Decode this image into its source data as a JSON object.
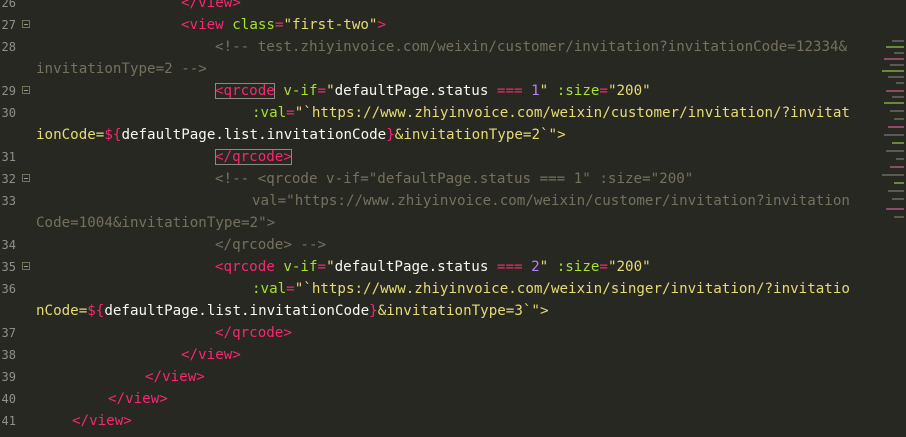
{
  "editor": {
    "lines": [
      {
        "num": "26",
        "fold": false,
        "text_a": "</view>"
      },
      {
        "num": "27",
        "fold": true
      },
      {
        "num": "28",
        "fold": false,
        "comment_a": "<!-- test.zhiyinvoice.com/weixin/customer/invitation?invitationCode=12334&",
        "comment_b": "invitationType=2 -->"
      },
      {
        "num": "29",
        "fold": true
      },
      {
        "num": "30",
        "fold": false
      },
      {
        "num": "31",
        "fold": false
      },
      {
        "num": "32",
        "fold": true,
        "comment_a": "<!-- <qrcode v-if=\"defaultPage.status === 1\" :size=\"200\""
      },
      {
        "num": "33",
        "fold": false,
        "comment_a": "val=\"https://www.zhiyinvoice.com/weixin/customer/invitation?invitation",
        "comment_b": "Code=1004&invitationType=2\">"
      },
      {
        "num": "34",
        "fold": false,
        "comment_a": "</qrcode> -->"
      },
      {
        "num": "35",
        "fold": true
      },
      {
        "num": "36",
        "fold": false
      },
      {
        "num": "37",
        "fold": false
      },
      {
        "num": "38",
        "fold": false
      },
      {
        "num": "39",
        "fold": false
      },
      {
        "num": "40",
        "fold": false
      },
      {
        "num": "41",
        "fold": false
      }
    ],
    "tokens": {
      "view_open": "<view",
      "class_attr": " class",
      "eq": "=",
      "first_two": "\"first-two\"",
      "gt": ">",
      "qrcode_open": "<qrcode",
      "qrcode_close": "</qrcode>",
      "view_close": "</view>",
      "vif": " v-if",
      "q": "\"",
      "status_expr": "defaultPage.status",
      "triple_eq": " === ",
      "one": "1",
      "two": "2",
      "size_attr": " :size",
      "size_val": "\"200\"",
      "val_attr": ":val",
      "tpl_open": "\"`",
      "url_customer_a": "https://www.zhiyinvoice.com/weixin/customer/invitation/?invitat",
      "url_customer_b": "ionCode=",
      "url_singer_a": "https://www.zhiyinvoice.com/weixin/singer/invitation/?invitatio",
      "url_singer_b": "nCode=",
      "interp_open": "${",
      "interp_expr": "defaultPage.list.invitationCode",
      "interp_close": "}",
      "tail_type2": "&invitationType=2`\">",
      "tail_type3": "&invitationType=3`\">"
    }
  }
}
